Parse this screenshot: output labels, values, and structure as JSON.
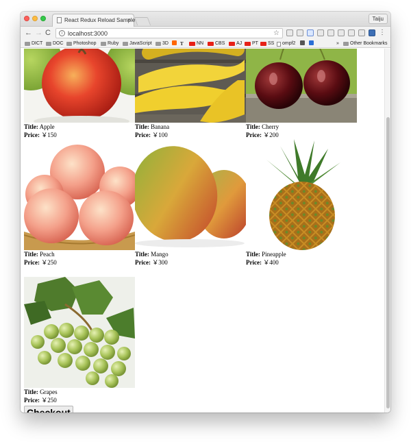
{
  "browser": {
    "tab_title": "React Redux Reload Sample",
    "tab_close": "×",
    "profile_name": "Taiju",
    "back_glyph": "←",
    "forward_glyph": "→",
    "reload_glyph": "C",
    "url": "localhost:3000",
    "star_glyph": "☆",
    "menu_glyph": "⋮",
    "more_bookmarks_glyph": "»"
  },
  "bookmarks": [
    {
      "label": "DICT",
      "icon": "folder-icon"
    },
    {
      "label": "DOC",
      "icon": "folder-icon"
    },
    {
      "label": "Photoshop",
      "icon": "folder-icon"
    },
    {
      "label": "Ruby",
      "icon": "folder-icon"
    },
    {
      "label": "JavaScript",
      "icon": "folder-icon"
    },
    {
      "label": "3D",
      "icon": "folder-icon"
    },
    {
      "label": "NN",
      "icon": "youtube-icon"
    },
    {
      "label": "CBS",
      "icon": "youtube-icon"
    },
    {
      "label": "AJ",
      "icon": "youtube-icon"
    },
    {
      "label": "PT",
      "icon": "youtube-icon"
    },
    {
      "label": "SS",
      "icon": "youtube-icon"
    },
    {
      "label": "ompf2",
      "icon": "doc-icon"
    },
    {
      "label": "Other Bookmarks",
      "icon": "folder-icon"
    }
  ],
  "labels": {
    "title": "Title:",
    "price": "Price:"
  },
  "products": [
    {
      "title": "Apple",
      "price": "￥150",
      "image": "apple"
    },
    {
      "title": "Banana",
      "price": "￥100",
      "image": "banana"
    },
    {
      "title": "Cherry",
      "price": "￥200",
      "image": "cherry"
    },
    {
      "title": "Peach",
      "price": "￥250",
      "image": "peach"
    },
    {
      "title": "Mango",
      "price": "￥300",
      "image": "mango"
    },
    {
      "title": "Pineapple",
      "price": "￥400",
      "image": "pineapple"
    },
    {
      "title": "Grapes",
      "price": "￥250",
      "image": "grapes"
    }
  ],
  "checkout_label": "Checkout",
  "colors": {
    "window_chrome": "#f2f2f2",
    "button_bg": "#ececec"
  }
}
